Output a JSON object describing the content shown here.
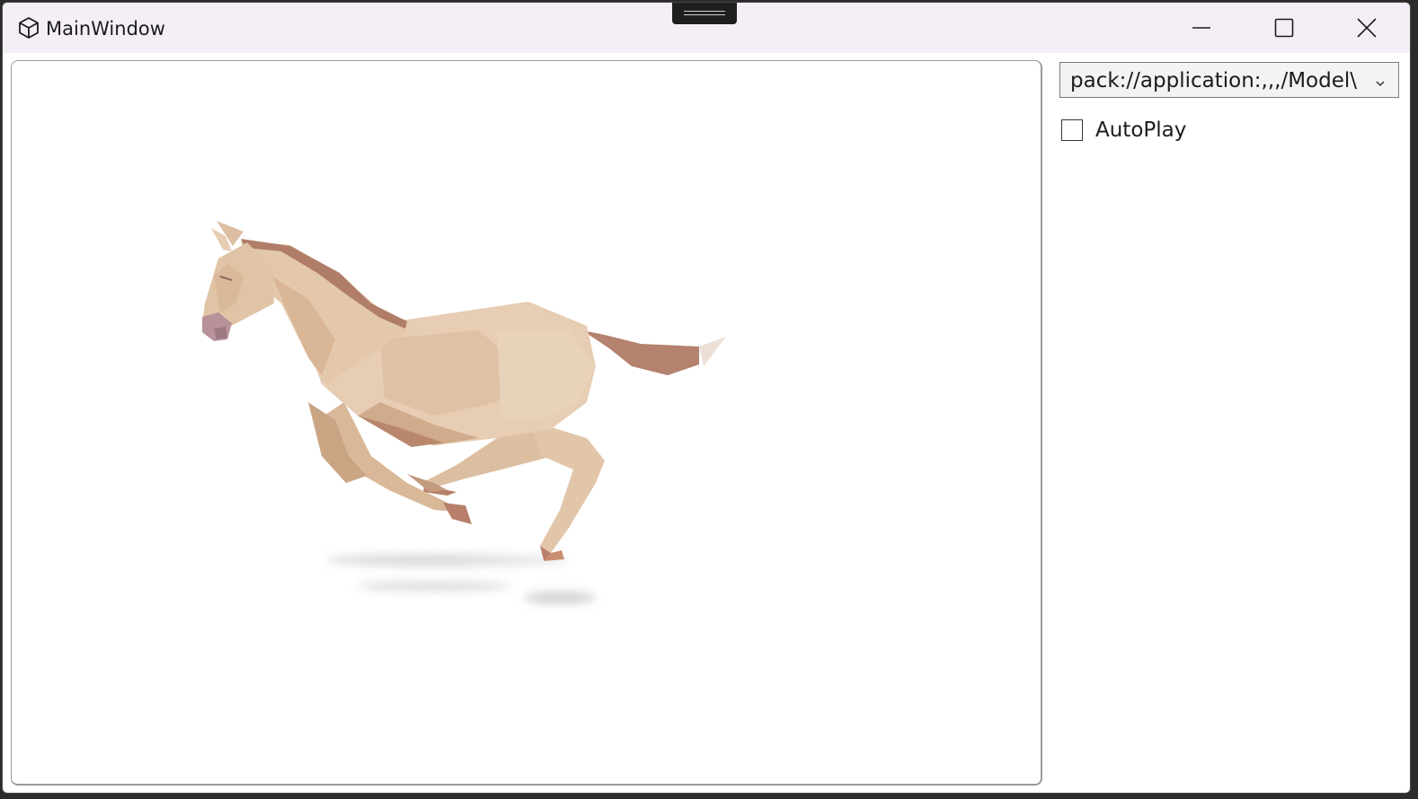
{
  "window": {
    "title": "MainWindow",
    "icon": "cube-icon"
  },
  "caption_buttons": {
    "minimize": "minimize-icon",
    "maximize": "maximize-icon",
    "close": "close-icon"
  },
  "viewport": {
    "model": "running-horse"
  },
  "controls": {
    "model_combo": {
      "selected": "pack://application:,,,/Model\\"
    },
    "autoplay": {
      "label": "AutoPlay",
      "checked": false
    }
  }
}
